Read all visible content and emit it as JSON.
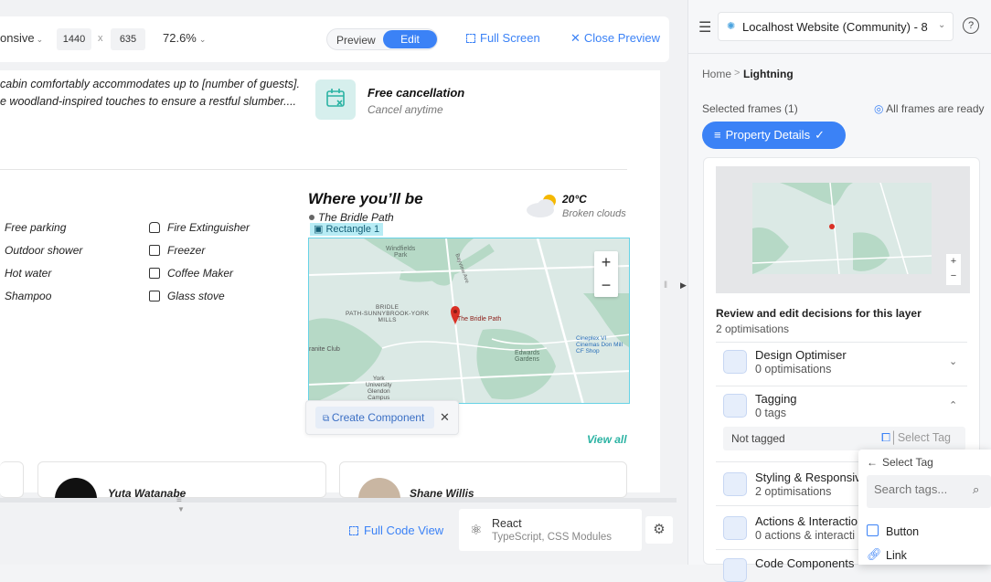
{
  "toolbar": {
    "device_label": "onsive",
    "width_value": "1440",
    "times_sign": "x",
    "height_value": "635",
    "zoom": "72.6%",
    "preview_label": "Preview",
    "edit_label": "Edit",
    "fullscreen_label": "Full Screen",
    "close_preview_label": "Close Preview"
  },
  "canvas": {
    "desc_line1": "cabin comfortably accommodates up to [number of guests].",
    "desc_line2": "e woodland-inspired touches to ensure a restful slumber....",
    "free_cancel_title": "Free cancellation",
    "free_cancel_sub": "Cancel anytime",
    "amenities_left": [
      "Free parking",
      "Outdoor shower",
      "Hot water",
      "Shampoo"
    ],
    "amenities_right": [
      "Fire Extinguisher",
      "Freezer",
      "Coffee Maker",
      "Glass stove"
    ],
    "where_title": "Where you’ll be",
    "location": "The Bridle Path",
    "weather_temp": "20°C",
    "weather_desc": "Broken clouds",
    "layer_tag": "Rectangle 1",
    "map_labels": {
      "windfields": "Windfields\nPark",
      "bridle": "BRIDLE\nPATH-SUNNYBROOK-YORK\nMILLS",
      "pin_label": "The Bridle Path",
      "granite": "ranite Club",
      "edwards": "Edwards\nGardens",
      "york": "York\nUniversity\nGlendon\nCampus",
      "cineplex": "Cineplex VI\nCinemas Don Mill\nCF Shop",
      "bayview": "Bayview Ave"
    },
    "create_component": "Create Component",
    "view_all": "View all",
    "review1_name": "Yuta Watanabe",
    "review2_name": "Shane Willis"
  },
  "bottombar": {
    "full_code_view": "Full Code View",
    "framework": "React",
    "framework_sub": "TypeScript, CSS Modules"
  },
  "panel": {
    "project_name": "Localhost Website (Community) - 8",
    "breadcrumb_home": "Home",
    "breadcrumb_sep": ">",
    "breadcrumb_current": "Lightning",
    "selected_frames": "Selected frames (1)",
    "frames_ready": "All frames are ready",
    "frame_chip": "Property Details",
    "review_title": "Review and edit decisions for this layer",
    "review_sub": "2 optimisations",
    "sections": [
      {
        "title": "Design Optimiser",
        "sub": "0 optimisations"
      },
      {
        "title": "Tagging",
        "sub": "0 tags"
      },
      {
        "title": "Styling & Responsiv",
        "sub": "2 optimisations"
      },
      {
        "title": "Actions & Interactio",
        "sub": "0 actions & interacti"
      },
      {
        "title": "Code Components",
        "sub": ""
      }
    ],
    "not_tagged": "Not tagged",
    "select_tag": "Select Tag",
    "dropdown": {
      "header": "Select Tag",
      "search_placeholder": "Search tags...",
      "items": [
        "Button",
        "Link"
      ]
    }
  },
  "colors": {
    "accent": "#3b82f6",
    "teal": "#2bb3a3",
    "map_outline": "#67d3e6"
  }
}
